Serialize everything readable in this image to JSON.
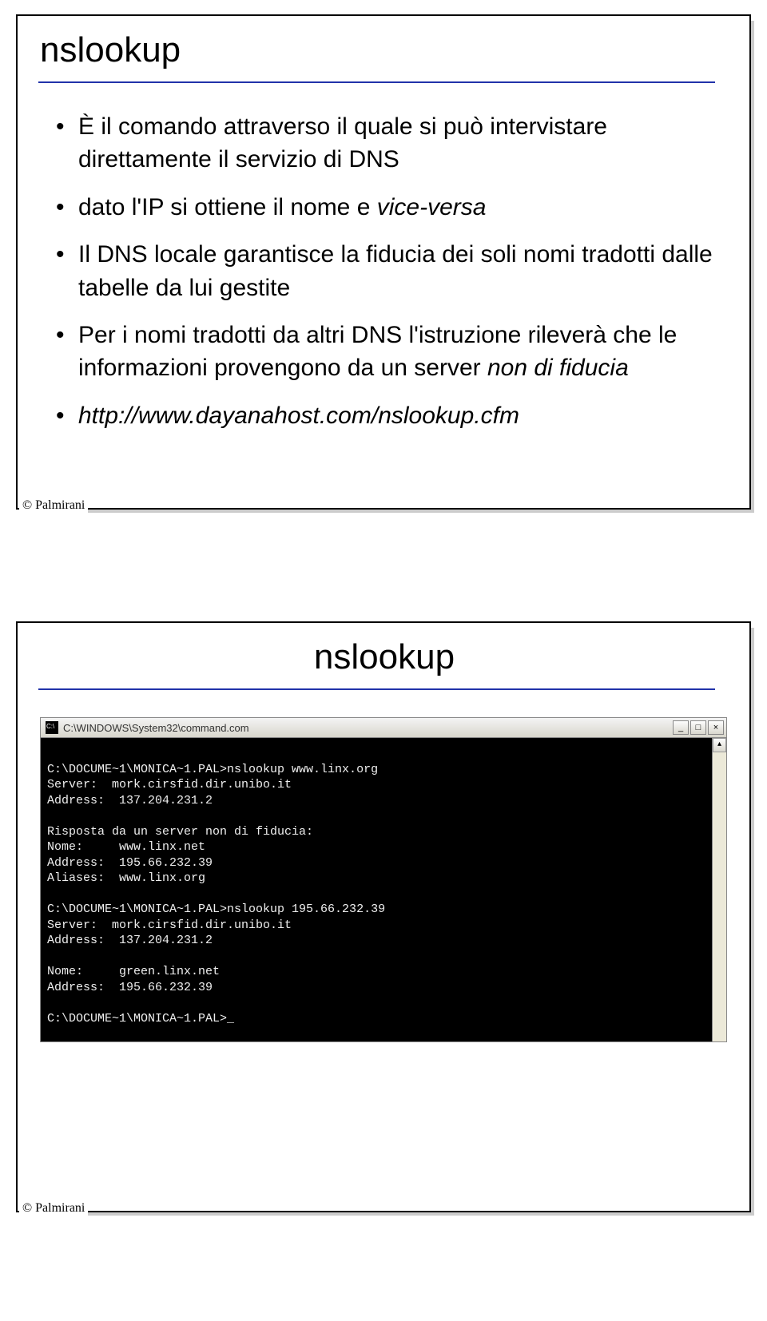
{
  "slide1": {
    "title": "nslookup",
    "bullets": [
      {
        "text": "È il comando attraverso il quale si può intervistare direttamente il servizio di DNS"
      },
      {
        "pre": "dato l'IP si ottiene il nome e ",
        "em": "vice-versa"
      },
      {
        "text": "Il DNS locale garantisce la fiducia dei soli nomi tradotti dalle tabelle da lui gestite"
      },
      {
        "pre": "Per i nomi tradotti da altri DNS l'istruzione rileverà che le informazioni provengono da un server ",
        "em": "non di fiducia"
      },
      {
        "em": "http://www.dayanahost.com/nslookup.cfm"
      }
    ],
    "copyright": "© Palmirani"
  },
  "slide2": {
    "title": "nslookup",
    "terminal": {
      "windowTitle": "C:\\WINDOWS\\System32\\command.com",
      "min": "_",
      "max": "□",
      "close": "×",
      "scrollUp": "▴",
      "body": "\nC:\\DOCUME~1\\MONICA~1.PAL>nslookup www.linx.org\nServer:  mork.cirsfid.dir.unibo.it\nAddress:  137.204.231.2\n\nRisposta da un server non di fiducia:\nNome:     www.linx.net\nAddress:  195.66.232.39\nAliases:  www.linx.org\n\nC:\\DOCUME~1\\MONICA~1.PAL>nslookup 195.66.232.39\nServer:  mork.cirsfid.dir.unibo.it\nAddress:  137.204.231.2\n\nNome:     green.linx.net\nAddress:  195.66.232.39\n\nC:\\DOCUME~1\\MONICA~1.PAL>_"
    },
    "copyright": "© Palmirani"
  }
}
